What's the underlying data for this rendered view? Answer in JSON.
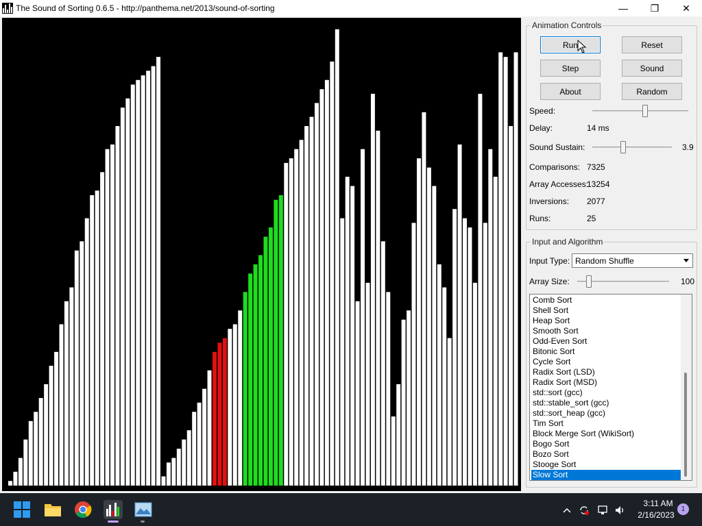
{
  "window": {
    "title": "The Sound of Sorting 0.6.5 - http://panthema.net/2013/sound-of-sorting",
    "minimize": "—",
    "maximize": "❐",
    "close": "✕"
  },
  "animation_controls": {
    "title": "Animation Controls",
    "buttons": {
      "run": "Run",
      "reset": "Reset",
      "step": "Step",
      "sound": "Sound",
      "about": "About",
      "random": "Random"
    },
    "speed_label": "Speed:",
    "speed_level": 0.55,
    "delay_label": "Delay:",
    "delay_value": "14 ms",
    "sustain_label": "Sound Sustain:",
    "sustain_value": "3.9",
    "sustain_level": 0.38,
    "stats": {
      "comparisons_label": "Comparisons:",
      "comparisons_value": "7325",
      "accesses_label": "Array Accesses:",
      "accesses_value": "13254",
      "inversions_label": "Inversions:",
      "inversions_value": "2077",
      "runs_label": "Runs:",
      "runs_value": "25"
    }
  },
  "input_algorithm": {
    "title": "Input and Algorithm",
    "input_type_label": "Input Type:",
    "input_type_value": "Random Shuffle",
    "array_size_label": "Array Size:",
    "array_size_value": "100",
    "array_size_level": 0.1,
    "algorithms": [
      "Comb Sort",
      "Shell Sort",
      "Heap Sort",
      "Smooth Sort",
      "Odd-Even Sort",
      "Bitonic Sort",
      "Cycle Sort",
      "Radix Sort (LSD)",
      "Radix Sort (MSD)",
      "std::sort (gcc)",
      "std::stable_sort (gcc)",
      "std::sort_heap (gcc)",
      "Tim Sort",
      "Block Merge Sort (WikiSort)",
      "Bogo Sort",
      "Bozo Sort",
      "Stooge Sort",
      "Slow Sort"
    ],
    "selected_algorithm": "Slow Sort"
  },
  "colors": {
    "bar_default": "#ffffff",
    "bar_compare": "#e41010",
    "bar_sorted_run": "#1fdc1f",
    "canvas_bg": "#000000",
    "selection": "#0078d7"
  },
  "array_bars": {
    "max_value": 100,
    "values": [
      1,
      3,
      6,
      10,
      14,
      16,
      19,
      22,
      26,
      29,
      35,
      40,
      43,
      51,
      53,
      58,
      63,
      64,
      68,
      73,
      74,
      78,
      82,
      84,
      87,
      88,
      89,
      90,
      91,
      93,
      2,
      5,
      6,
      8,
      10,
      12,
      16,
      18,
      21,
      25,
      29,
      31,
      32,
      34,
      35,
      38,
      42,
      46,
      48,
      50,
      54,
      56,
      62,
      63,
      70,
      71,
      73,
      75,
      78,
      80,
      83,
      86,
      88,
      92,
      99,
      58,
      67,
      65,
      40,
      73,
      44,
      85,
      77,
      53,
      42,
      15,
      22,
      36,
      38,
      57,
      71,
      81,
      69,
      65,
      48,
      43,
      32,
      60,
      74,
      58,
      56,
      44,
      85,
      57,
      73,
      67,
      94,
      93,
      78,
      94
    ],
    "compare_indices": [
      40,
      41,
      42
    ],
    "run_indices": [
      46,
      47,
      48,
      49,
      50,
      51,
      52,
      53
    ]
  },
  "taskbar": {
    "time": "3:11 AM",
    "date": "2/16/2023",
    "notifications": "1",
    "items": [
      "start-icon",
      "file-explorer-icon",
      "chrome-icon",
      "sound-of-sorting-icon",
      "image-viewer-icon"
    ]
  }
}
